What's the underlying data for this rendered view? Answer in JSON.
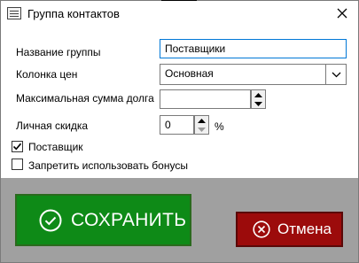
{
  "window": {
    "title": "Группа контактов",
    "close_glyph": "✕",
    "icon": "app-window-icon"
  },
  "form": {
    "group_name": {
      "label": "Название группы",
      "value": "Поставщики"
    },
    "price_column": {
      "label": "Колонка цен",
      "value": "Основная"
    },
    "max_debt": {
      "label": "Максимальная сумма долга",
      "value": ""
    },
    "personal_discount": {
      "label": "Личная скидка",
      "value": "0",
      "unit": "%"
    },
    "supplier": {
      "label": "Поставщик",
      "checked": true
    },
    "no_bonuses": {
      "label": "Запретить использовать бонусы",
      "checked": false
    }
  },
  "actions": {
    "save_label": "СОХРАНИТЬ",
    "cancel_label": "Отмена"
  },
  "colors": {
    "save_bg": "#0e8a17",
    "cancel_bg": "#9c0b0b",
    "bottom_panel": "#a0a0a0",
    "focus_border": "#0078d7"
  }
}
